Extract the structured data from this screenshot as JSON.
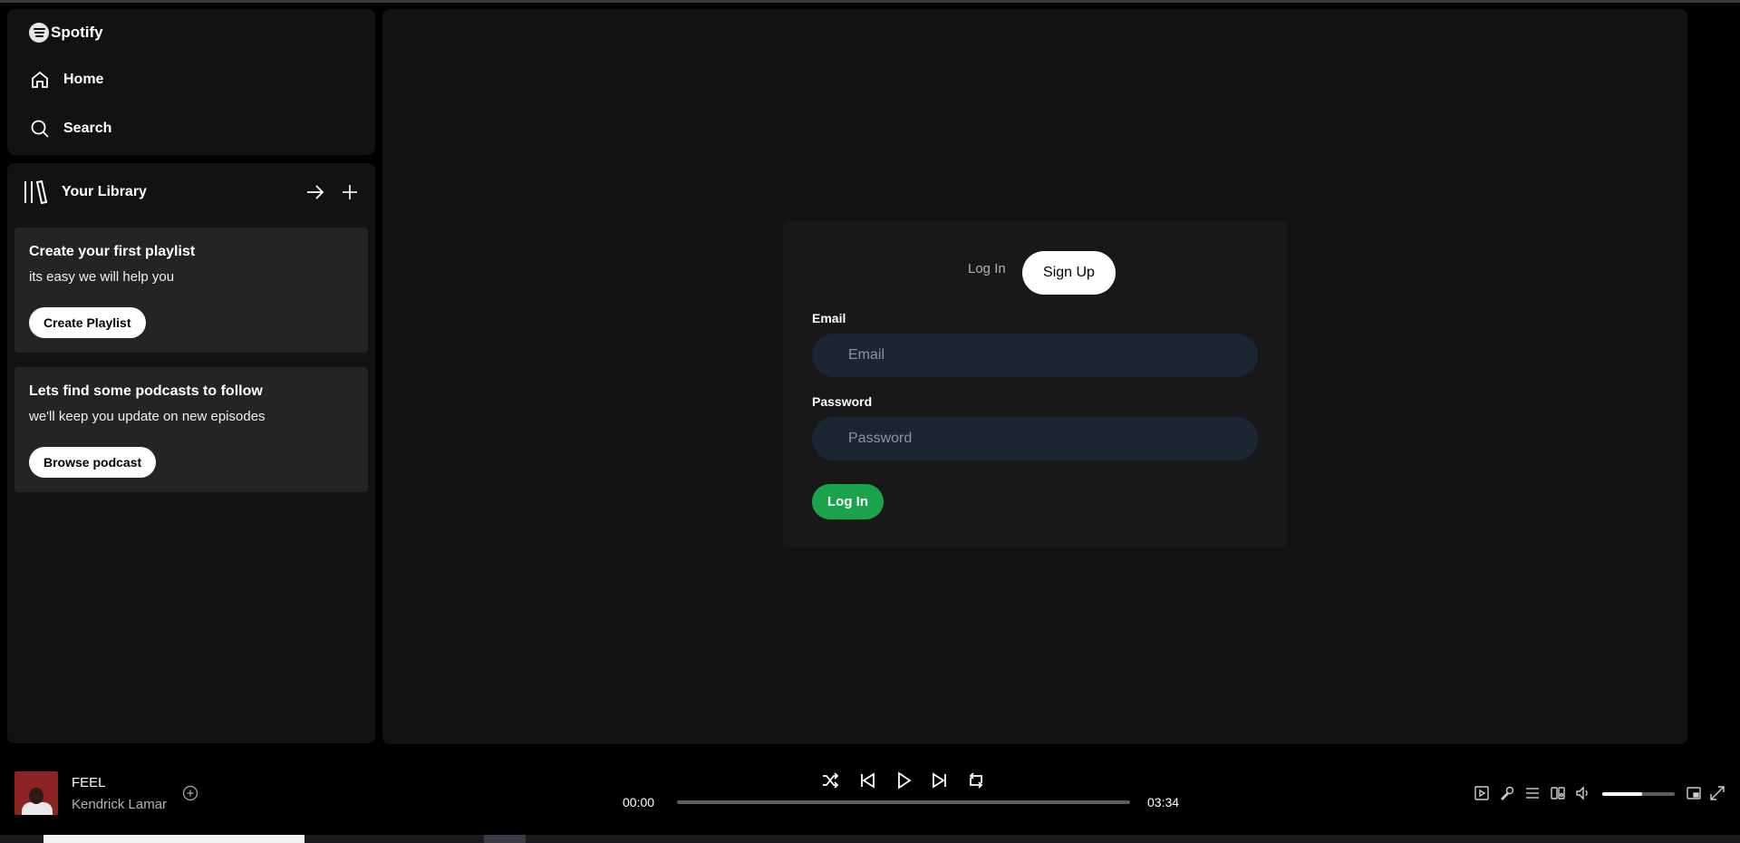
{
  "app": {
    "name": "Spotify"
  },
  "nav": {
    "home_label": "Home",
    "search_label": "Search"
  },
  "library": {
    "title": "Your Library",
    "cards": [
      {
        "title": "Create your first playlist",
        "subtitle": "its easy we will help you",
        "button": "Create Playlist"
      },
      {
        "title": "Lets find some podcasts to follow",
        "subtitle": "we'll keep you update on new episodes",
        "button": "Browse podcast"
      }
    ]
  },
  "auth": {
    "tab_login": "Log In",
    "tab_signup": "Sign Up",
    "active_tab": "Sign Up",
    "email_label": "Email",
    "email_placeholder": "Email",
    "password_label": "Password",
    "password_placeholder": "Password",
    "submit_label": "Log In",
    "accent_color": "#1aa34a"
  },
  "player": {
    "track_title": "FEEL",
    "artist": "Kendrick Lamar",
    "current_time": "00:00",
    "duration": "03:34",
    "progress_fraction": 0,
    "volume_fraction": 0.55
  }
}
